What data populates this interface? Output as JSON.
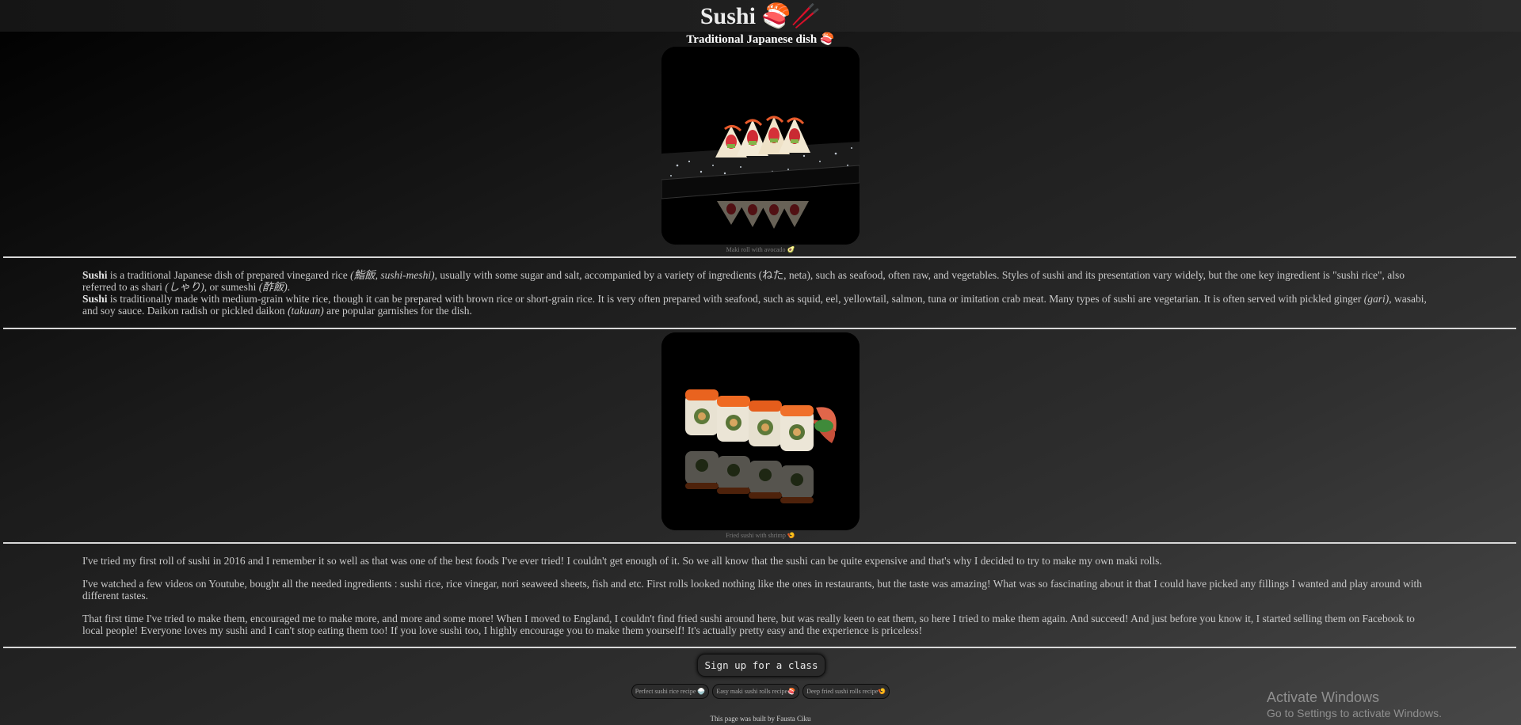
{
  "header": {
    "title": "Sushi 🍣🥢",
    "subtitle": "Traditional Japanese dish 🍣"
  },
  "images": [
    {
      "caption": "Maki roll with avocado 🥑",
      "icon": "maki-avocado-photo"
    },
    {
      "caption": "Fried sushi with shrimp 🍤",
      "icon": "fried-sushi-photo"
    }
  ],
  "intro": {
    "p1": {
      "bold": "Sushi",
      "t1": " is a traditional Japanese dish of prepared vinegared rice ",
      "i1": "(鮨飯, sushi-meshi)",
      "t2": ", usually with some sugar and salt, accompanied by a variety of ingredients (ねた, neta), such as seafood, often raw, and vegetables. Styles of sushi and its presentation vary widely, but the one key ingredient is \"sushi rice\", also referred to as shari ",
      "i2": "(しゃり)",
      "t3": ", or sumeshi ",
      "i3": "(酢飯)",
      "t4": "."
    },
    "p2": {
      "bold": "Sushi",
      "t1": " is traditionally made with medium-grain white rice, though it can be prepared with brown rice or short-grain rice. It is very often prepared with seafood, such as squid, eel, yellowtail, salmon, tuna or imitation crab meat. Many types of sushi are vegetarian. It is often served with pickled ginger ",
      "i1": "(gari)",
      "t2": ", wasabi, and soy sauce. Daikon radish or pickled daikon ",
      "i2": "(takuan)",
      "t3": " are popular garnishes for the dish."
    }
  },
  "story": [
    "I've tried my first roll of sushi in 2016 and I remember it so well as that was one of the best foods I've ever tried! I couldn't get enough of it. So we all know that the sushi can be quite expensive and that's why I decided to try to make my own maki rolls.",
    "I've watched a few videos on Youtube, bought all the needed ingredients : sushi rice, rice vinegar, nori seaweed sheets, fish and etc. First rolls looked nothing like the ones in restaurants, but the taste was amazing! What was so fascinating about it that I could have picked any fillings I wanted and play around with different tastes.",
    "That first time I've tried to make them, encouraged me to make more, and more and some more! When I moved to England, I couldn't find fried sushi around here, but was really keen to eat them, so here I tried to make them again. And succeed! And just before you know it, I started selling them on Facebook to local people! Everyone loves my sushi and I can't stop eating them too! If you love sushi too, I highly encourage you to make them yourself! It's actually pretty easy and the experience is priceless!"
  ],
  "cta": {
    "label": "Sign up for a class"
  },
  "recipes": [
    "Perfect sushi rice recipe 🍚",
    "Easy maki sushi rolls recipe🍣",
    "Deep fried sushi rolls recipe🍤"
  ],
  "footer": "This page was built by Fausta Ciku",
  "watermark": {
    "title": "Activate Windows",
    "subtitle": "Go to Settings to activate Windows."
  },
  "colors": {
    "background_dark": "#000000",
    "background_light": "#474747",
    "text": "#c9c9c9",
    "divider": "#d8d8d8"
  }
}
